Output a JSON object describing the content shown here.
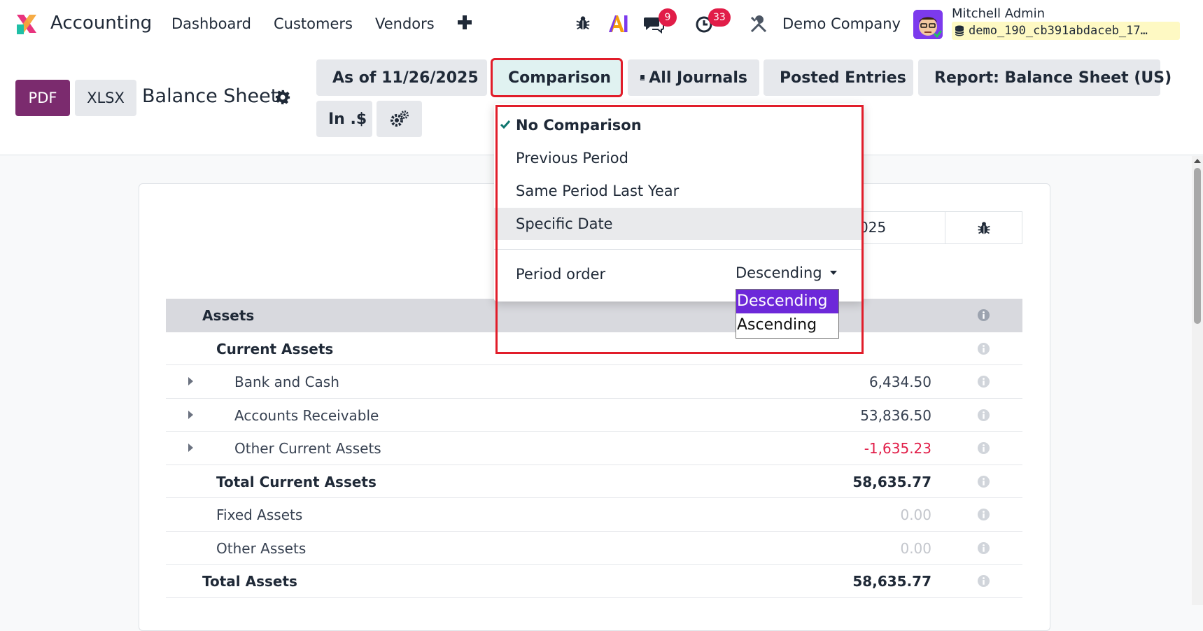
{
  "navbar": {
    "app_name": "Accounting",
    "menus": [
      "Dashboard",
      "Customers",
      "Vendors"
    ],
    "messages_badge": "9",
    "activities_badge": "33",
    "company": "Demo Company",
    "user_name": "Mitchell Admin",
    "database": "demo_190_cb391abdaceb_17…"
  },
  "toolbar": {
    "pdf_label": "PDF",
    "xlsx_label": "XLSX",
    "report_title": "Balance Sheet",
    "filters": {
      "date": "As of 11/26/2025",
      "comparison": "Comparison",
      "journals": "All Journals",
      "entries": "Posted Entries",
      "report": "Report: Balance Sheet (US)",
      "currency": "In .$"
    }
  },
  "comparison_menu": {
    "options": [
      "No Comparison",
      "Previous Period",
      "Same Period Last Year",
      "Specific Date"
    ],
    "selected": "No Comparison",
    "period_order_label": "Period order",
    "period_order_value": "Descending",
    "period_order_options": [
      "Descending",
      "Ascending"
    ]
  },
  "report": {
    "column_date_partial": "025",
    "rows": [
      {
        "label": "Assets",
        "value": ""
      },
      {
        "label": "Current Assets",
        "value": ""
      },
      {
        "label": "Bank and Cash",
        "value": "6,434.50"
      },
      {
        "label": "Accounts Receivable",
        "value": "53,836.50"
      },
      {
        "label": "Other Current Assets",
        "value": "-1,635.23"
      },
      {
        "label": "Total Current Assets",
        "value": "58,635.77"
      },
      {
        "label": "Fixed Assets",
        "value": "0.00"
      },
      {
        "label": "Other Assets",
        "value": "0.00"
      },
      {
        "label": "Total Assets",
        "value": "58,635.77"
      }
    ]
  },
  "colors": {
    "brand": "#7b2b6e",
    "highlight": "#e11d2a",
    "badge": "#e11d48",
    "negative": "#e11d48",
    "select_active": "#6d28d9",
    "check": "#0f766e"
  }
}
